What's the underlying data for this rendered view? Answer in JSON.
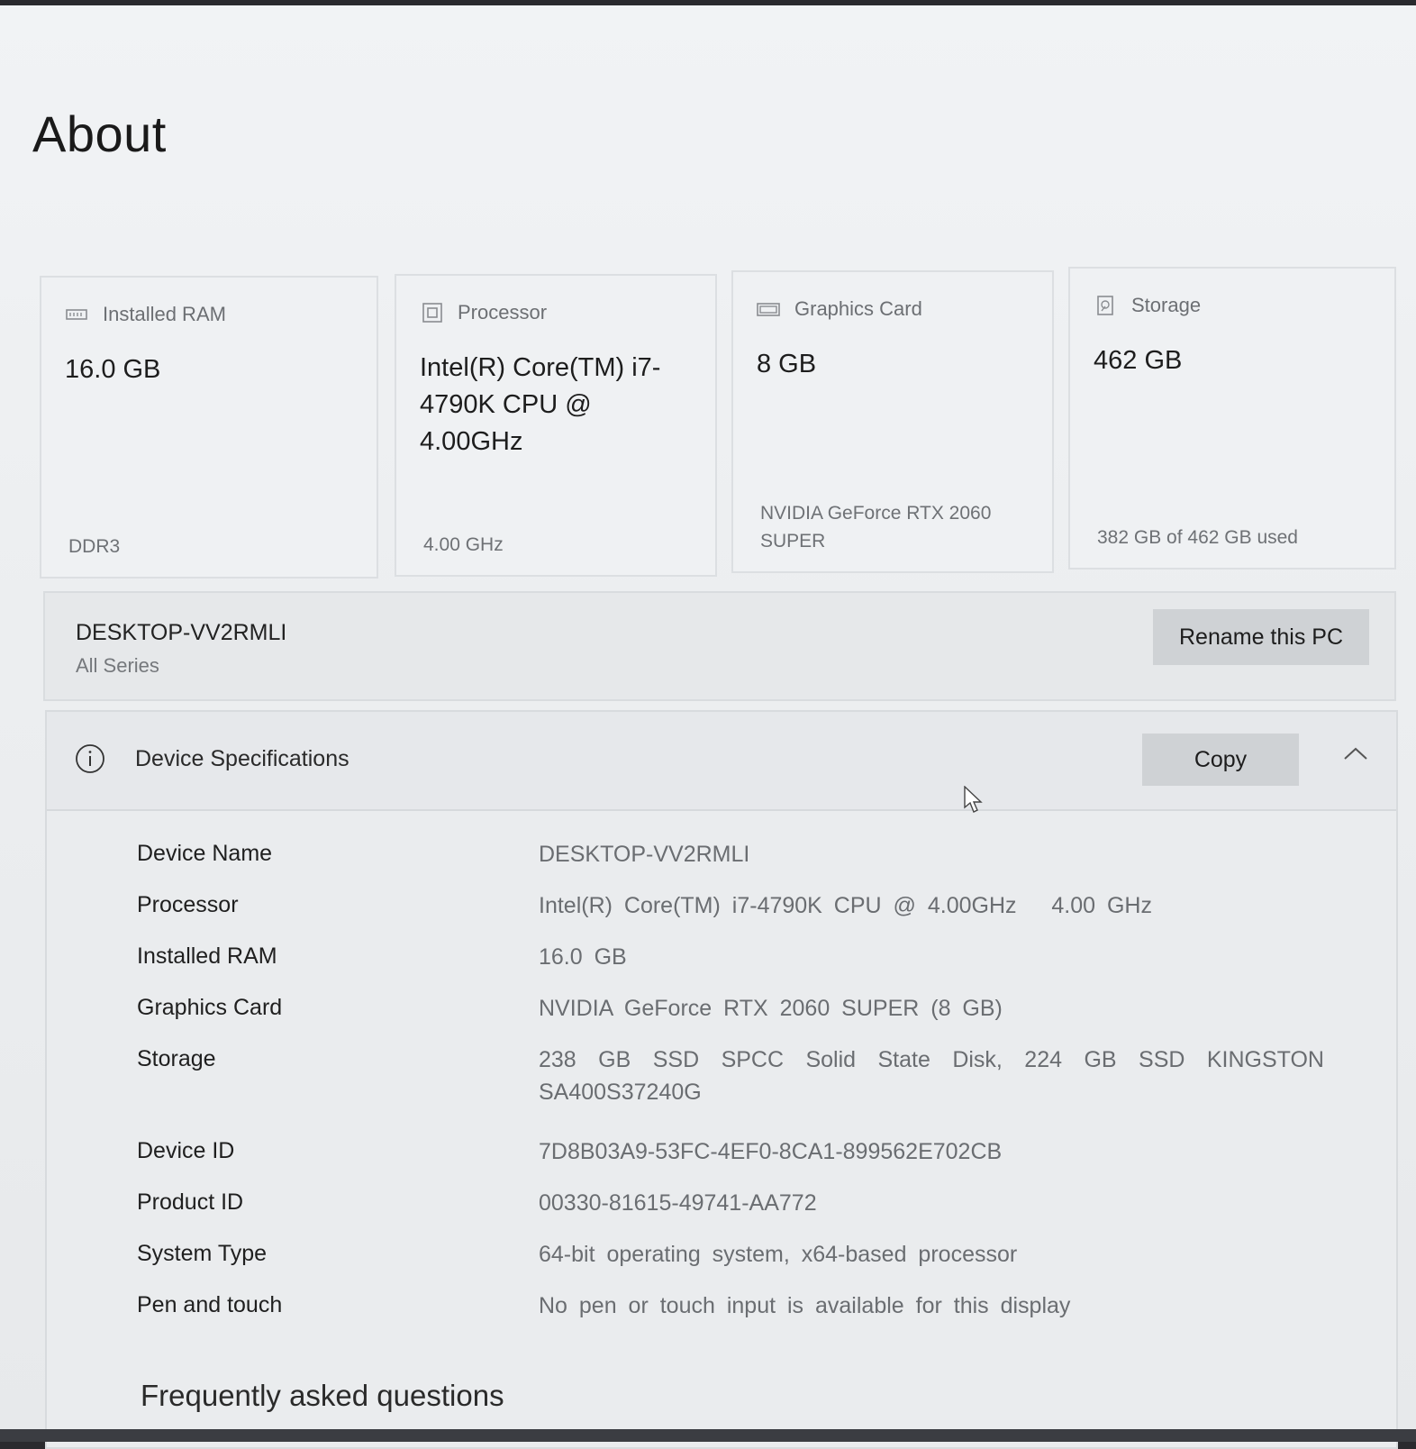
{
  "page": {
    "title": "About"
  },
  "cards": {
    "ram": {
      "label": "Installed RAM",
      "value": "16.0 GB",
      "sub": "DDR3",
      "icon": "ram-icon"
    },
    "processor": {
      "label": "Processor",
      "value": "Intel(R) Core(TM) i7-4790K CPU @ 4.00GHz",
      "sub": "4.00 GHz",
      "icon": "processor-icon"
    },
    "graphics": {
      "label": "Graphics Card",
      "value": "8 GB",
      "sub": "NVIDIA GeForce RTX 2060 SUPER",
      "icon": "graphics-card-icon"
    },
    "storage": {
      "label": "Storage",
      "value": "462 GB",
      "sub": "382 GB of 462 GB used",
      "icon": "storage-icon"
    }
  },
  "pc": {
    "name": "DESKTOP-VV2RMLI",
    "model": "All Series",
    "rename_label": "Rename this PC"
  },
  "specs": {
    "title": "Device Specifications",
    "copy_label": "Copy",
    "rows": [
      {
        "label": "Device Name",
        "value": "DESKTOP-VV2RMLI"
      },
      {
        "label": "Processor",
        "value": "Intel(R) Core(TM) i7-4790K CPU @ 4.00GHz   4.00 GHz"
      },
      {
        "label": "Installed RAM",
        "value": "16.0 GB"
      },
      {
        "label": "Graphics Card",
        "value": "NVIDIA GeForce RTX 2060 SUPER (8 GB)"
      },
      {
        "label": "Storage",
        "value": "238 GB SSD SPCC Solid State Disk, 224 GB SSD KINGSTON SA400S37240G"
      },
      {
        "label": "Device ID",
        "value": "7D8B03A9-53FC-4EF0-8CA1-899562E702CB"
      },
      {
        "label": "Product ID",
        "value": "00330-81615-49741-AA772"
      },
      {
        "label": "System Type",
        "value": "64-bit operating system, x64-based processor"
      },
      {
        "label": "Pen and touch",
        "value": "No pen or touch input is available for this display"
      }
    ]
  },
  "faq": {
    "heading": "Frequently asked questions"
  }
}
